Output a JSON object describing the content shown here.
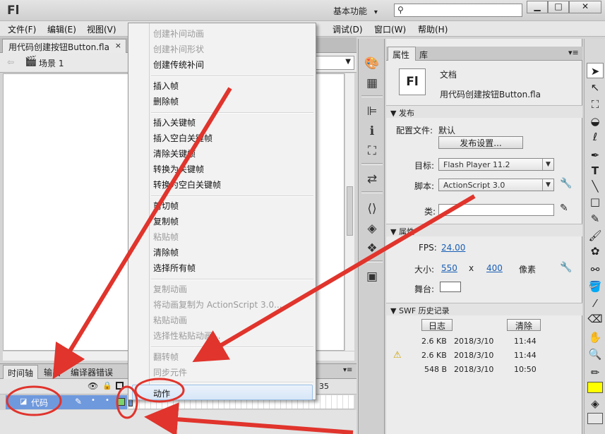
{
  "app": {
    "logo": "Fl",
    "workspace": "基本功能",
    "workspace_arrow": "▾",
    "search_placeholder": ""
  },
  "window_controls": [
    "▁",
    "□",
    "✕"
  ],
  "menubar": [
    "文件(F)",
    "编辑(E)",
    "视图(V)",
    "调试(D)",
    "窗口(W)",
    "帮助(H)"
  ],
  "document": {
    "tab_title": "用代码创建按钮Button.fla",
    "tab_close": "×",
    "scene": "场景 1"
  },
  "timeline": {
    "tabs": [
      "时间轴",
      "输出",
      "编译器错误"
    ],
    "frame_marker": "35",
    "layer_name": "代码"
  },
  "context_menu": {
    "items": [
      {
        "label": "创建补间动画",
        "disabled": true
      },
      {
        "label": "创建补间形状",
        "disabled": true
      },
      {
        "label": "创建传统补间",
        "disabled": false
      },
      {
        "label": "插入帧",
        "disabled": false
      },
      {
        "label": "删除帧",
        "disabled": false
      },
      {
        "label": "插入关键帧",
        "disabled": false
      },
      {
        "label": "插入空白关键帧",
        "disabled": false
      },
      {
        "label": "清除关键帧",
        "disabled": false
      },
      {
        "label": "转换为关键帧",
        "disabled": false
      },
      {
        "label": "转换为空白关键帧",
        "disabled": false
      },
      {
        "label": "剪切帧",
        "disabled": false
      },
      {
        "label": "复制帧",
        "disabled": false
      },
      {
        "label": "粘贴帧",
        "disabled": true
      },
      {
        "label": "清除帧",
        "disabled": false
      },
      {
        "label": "选择所有帧",
        "disabled": false
      },
      {
        "label": "复制动画",
        "disabled": true
      },
      {
        "label": "将动画复制为 ActionScript 3.0...",
        "disabled": true
      },
      {
        "label": "粘贴动画",
        "disabled": true
      },
      {
        "label": "选择性粘贴动画...",
        "disabled": true
      },
      {
        "label": "翻转帧",
        "disabled": true
      },
      {
        "label": "同步元件",
        "disabled": true
      },
      {
        "label": "动作",
        "disabled": false,
        "highlighted": true
      }
    ]
  },
  "properties": {
    "tabs": [
      "属性",
      "库"
    ],
    "doc_icon": "Fl",
    "doc_type": "文档",
    "doc_name": "用代码创建按钮Button.fla",
    "publish": {
      "section": "发布",
      "profile_label": "配置文件:",
      "profile_value": "默认",
      "settings_button": "发布设置...",
      "target_label": "目标:",
      "target_value": "Flash Player 11.2",
      "script_label": "脚本:",
      "script_value": "ActionScript 3.0",
      "class_label": "类:"
    },
    "props": {
      "section": "属性",
      "fps_label": "FPS:",
      "fps_value": "24.00",
      "size_label": "大小:",
      "width": "550",
      "x": "x",
      "height": "400",
      "unit": "像素",
      "stage_label": "舞台:"
    },
    "swf_history": {
      "section": "SWF 历史记录",
      "log_button": "日志",
      "clear_button": "清除",
      "rows": [
        {
          "size": "2.6 KB",
          "date": "2018/3/10",
          "time": "11:44",
          "warning": false
        },
        {
          "size": "2.6 KB",
          "date": "2018/3/10",
          "time": "11:44",
          "warning": true
        },
        {
          "size": "548 B",
          "date": "2018/3/10",
          "time": "10:50",
          "warning": false
        }
      ]
    }
  },
  "colors": {
    "annotation_red": "#e0342c",
    "layer_selected": "#6f99dd",
    "menu_highlight": "#d7e6f7"
  }
}
